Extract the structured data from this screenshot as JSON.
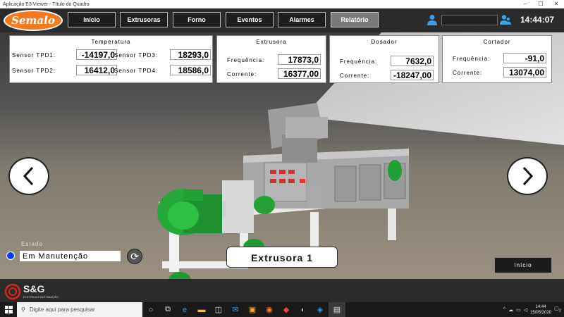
{
  "window": {
    "title": "Aplicação E3 Viewer - Título do Quadro",
    "controls": [
      "–",
      "☐",
      "✕"
    ]
  },
  "brand": {
    "logo": "Semalo"
  },
  "nav": {
    "items": [
      {
        "label": "Início",
        "active": false
      },
      {
        "label": "Extrusoras",
        "active": false
      },
      {
        "label": "Forno",
        "active": false
      },
      {
        "label": "Eventos",
        "active": false
      },
      {
        "label": "Alarmes",
        "active": false
      },
      {
        "label": "Relatório",
        "active": true
      }
    ]
  },
  "header": {
    "user_value": "",
    "clock": "14:44:07"
  },
  "temperatura": {
    "title": "Temperatura",
    "tpd1_label": "Sensor TPD1:",
    "tpd1": "-14197,0",
    "tpd2_label": "Sensor TPD2:",
    "tpd2": "16412,0",
    "tpd3_label": "Sensor TPD3:",
    "tpd3": "18293,0",
    "tpd4_label": "Sensor TPD4:",
    "tpd4": "18586,0"
  },
  "extrusora": {
    "title": "Extrusora",
    "freq_label": "Frequência:",
    "freq": "17873,0",
    "corr_label": "Corrente:",
    "corr": "16377,00"
  },
  "dosador": {
    "title": "Dosador",
    "freq_label": "Frequência:",
    "freq": "7632,0",
    "corr_label": "Corrente:",
    "corr": "-18247,00"
  },
  "cortador": {
    "title": "Cortador",
    "freq_label": "Frequência:",
    "freq": "-91,0",
    "corr_label": "Corrente:",
    "corr": "13074,00"
  },
  "estado": {
    "label": "Estado",
    "value": "Em Manutenção",
    "status_color": "#0a3cff"
  },
  "machine": {
    "name": "Extrusora 1"
  },
  "inicio_button": "Início",
  "footer": {
    "brand": "S&G",
    "subtitle": "ELETRICA E AUTOMAÇÃO"
  },
  "taskbar": {
    "search_placeholder": "Digite aqui para pesquisar",
    "time": "14:44",
    "date": "15/05/2020",
    "notifications": "2"
  }
}
